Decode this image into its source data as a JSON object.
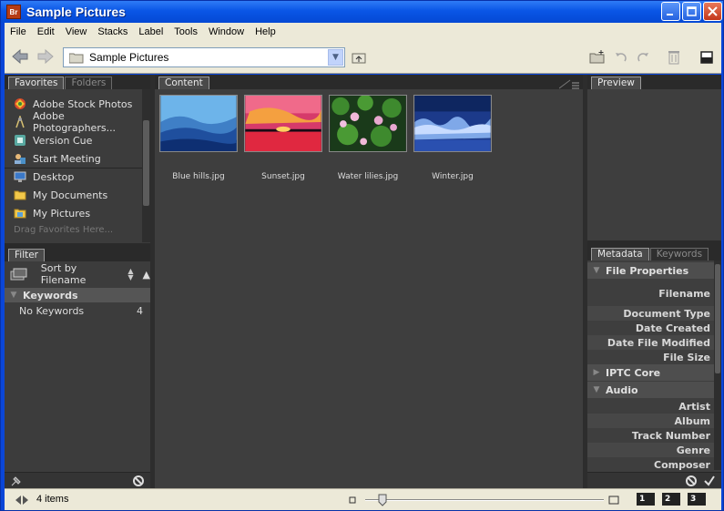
{
  "window": {
    "title": "Sample Pictures",
    "app_icon": "Br"
  },
  "menu": [
    "File",
    "Edit",
    "View",
    "Stacks",
    "Label",
    "Tools",
    "Window",
    "Help"
  ],
  "path": {
    "folder": "Sample Pictures"
  },
  "favorites_panel": {
    "tabs": [
      "Favorites",
      "Folders"
    ],
    "items": [
      "Adobe Stock Photos",
      "Adobe Photographers...",
      "Version Cue",
      "Start Meeting",
      "Desktop",
      "My Documents",
      "My Pictures"
    ],
    "drag_hint": "Drag Favorites Here..."
  },
  "filter_panel": {
    "tab": "Filter",
    "sort_label": "Sort by Filename",
    "section": "Keywords",
    "rows": [
      {
        "label": "No Keywords",
        "count": "4"
      }
    ]
  },
  "content_panel": {
    "tab": "Content",
    "items": [
      {
        "name": "Blue hills.jpg",
        "icon": "blue-hills-thumbnail"
      },
      {
        "name": "Sunset.jpg",
        "icon": "sunset-thumbnail"
      },
      {
        "name": "Water lilies.jpg",
        "icon": "water-lilies-thumbnail"
      },
      {
        "name": "Winter.jpg",
        "icon": "winter-thumbnail"
      }
    ]
  },
  "preview_panel": {
    "tab": "Preview"
  },
  "metadata_panel": {
    "tabs": [
      "Metadata",
      "Keywords"
    ],
    "file_properties": {
      "title": "File Properties",
      "fields": [
        "Filename",
        "Document Type",
        "Date Created",
        "Date File Modified",
        "File Size"
      ]
    },
    "iptc": {
      "title": "IPTC Core"
    },
    "audio": {
      "title": "Audio",
      "fields": [
        "Artist",
        "Album",
        "Track Number",
        "Genre",
        "Composer"
      ]
    }
  },
  "status": {
    "items": "4 items",
    "views": [
      "1",
      "2",
      "3"
    ]
  },
  "colors": {
    "accent": "#0a46d8",
    "panel": "#3c3c3c"
  }
}
